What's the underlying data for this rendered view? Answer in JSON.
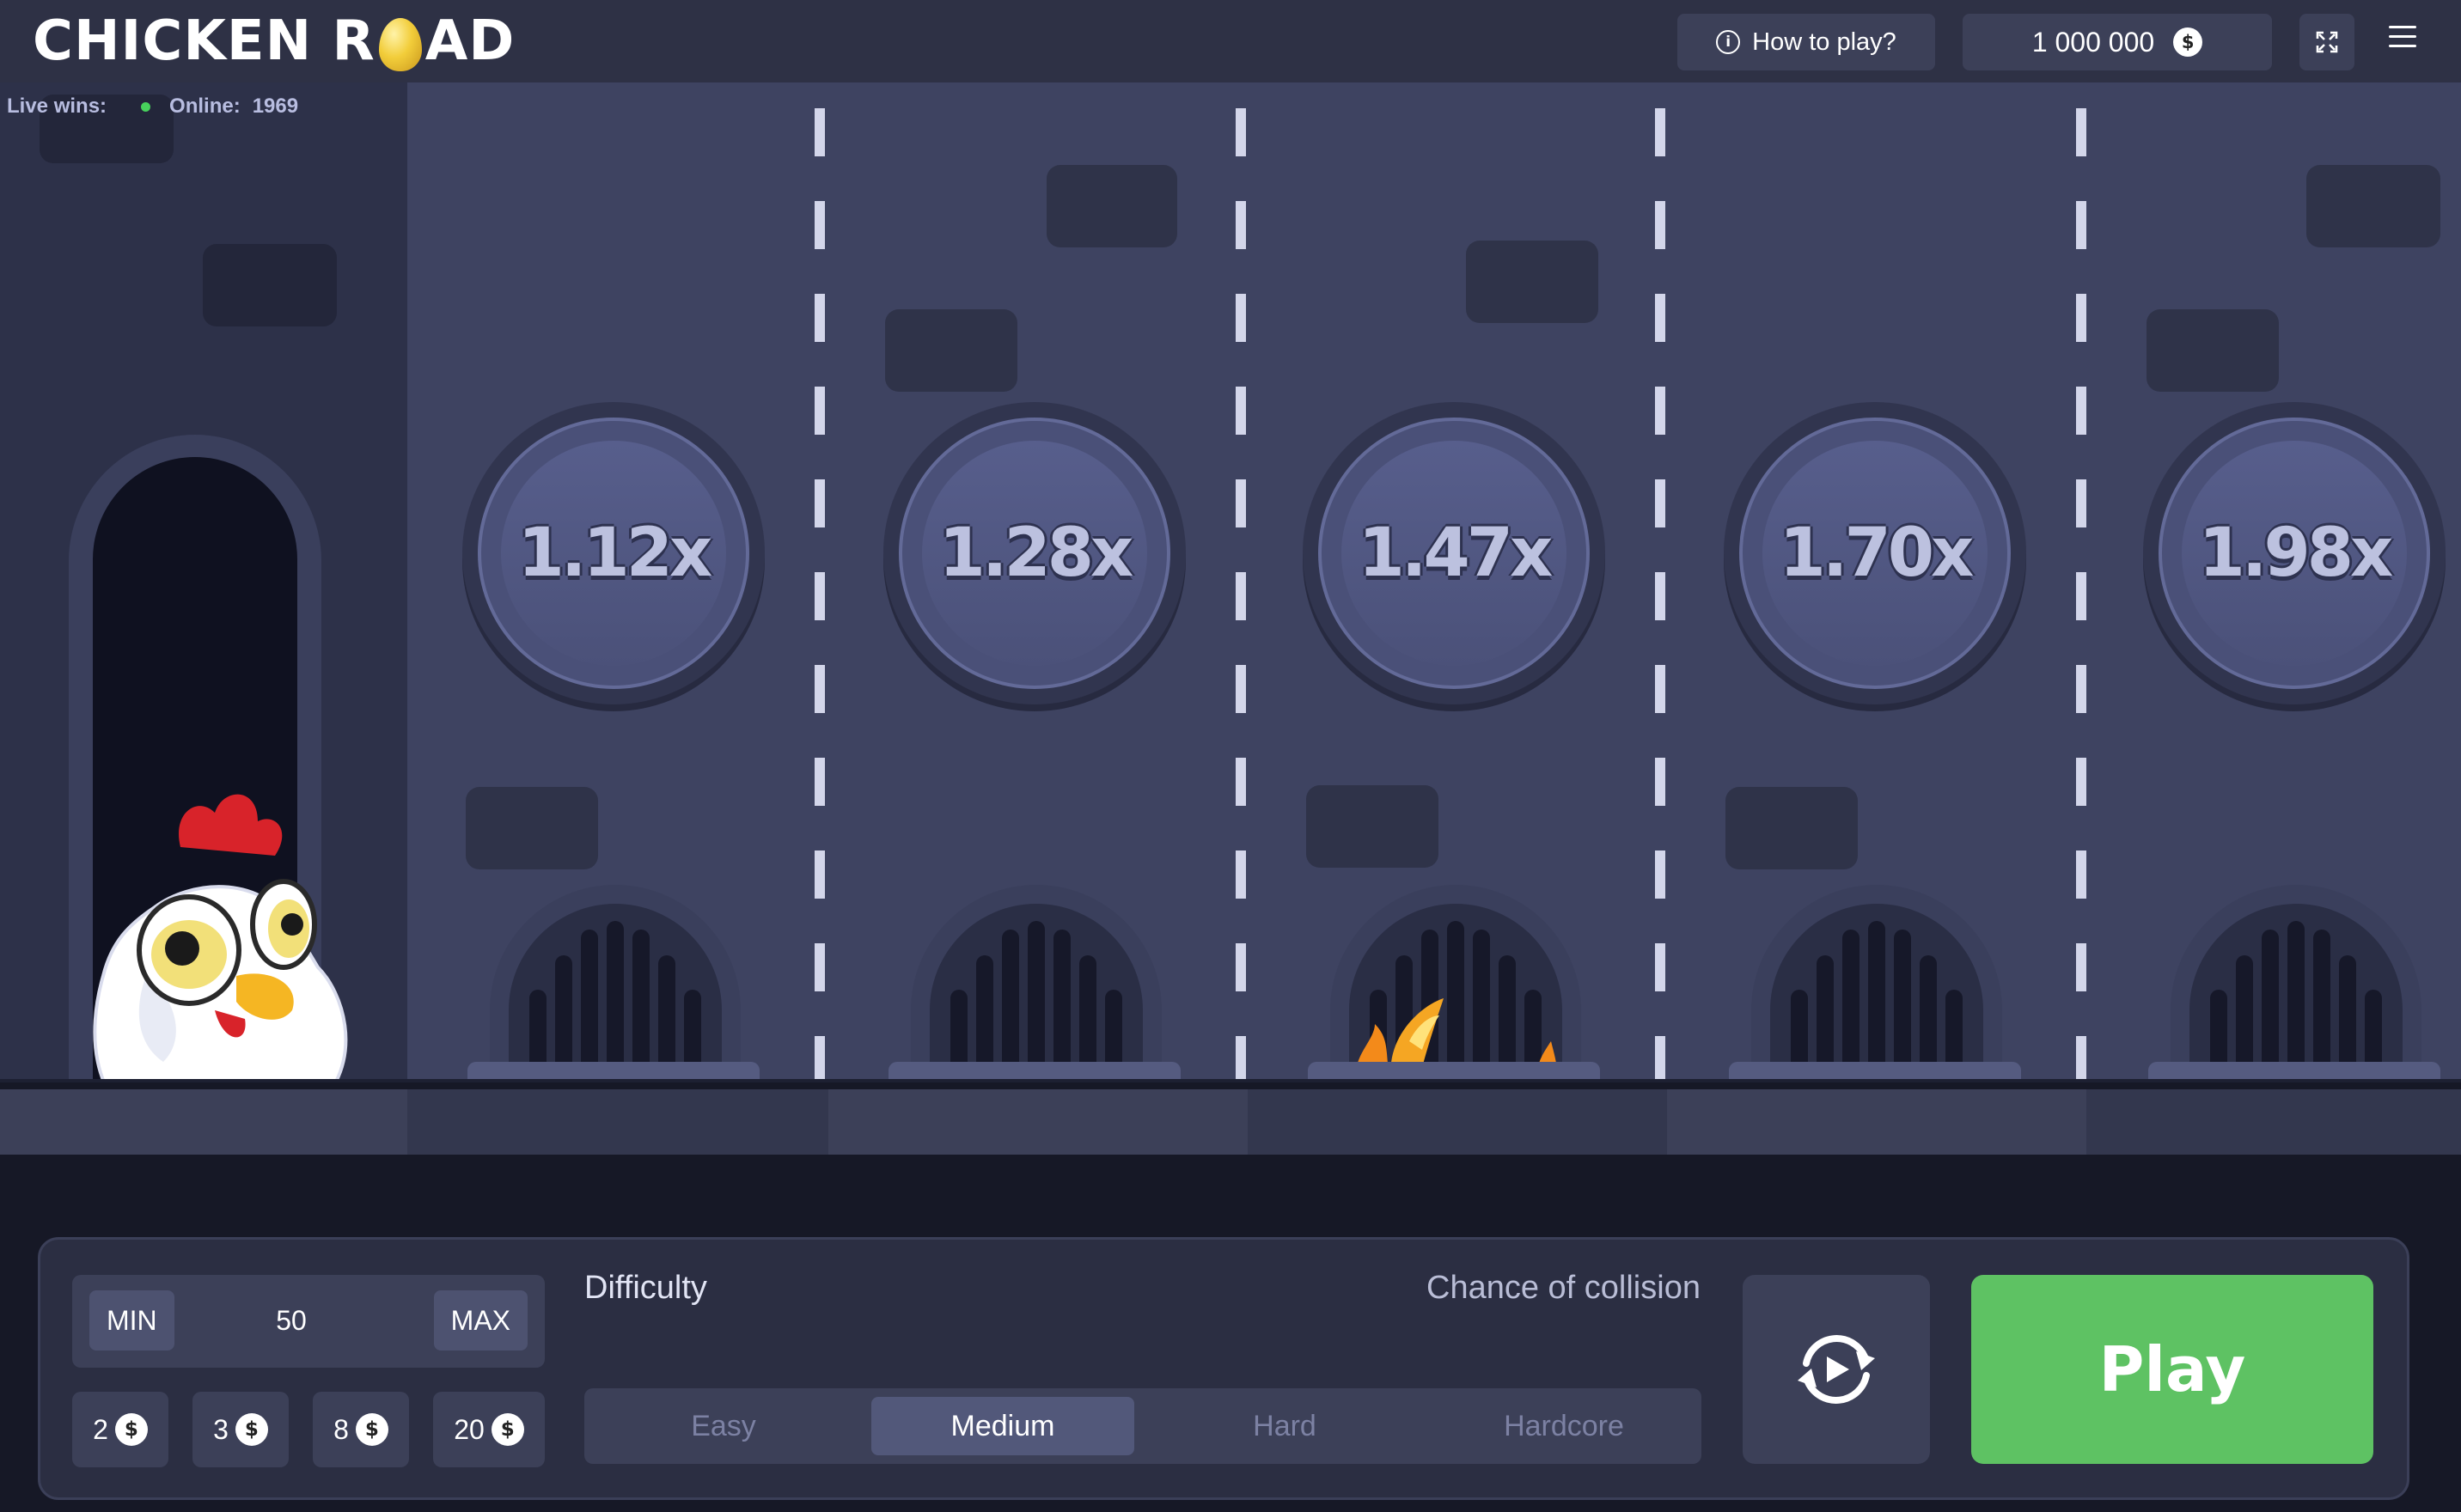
{
  "header": {
    "logo_text_1": "CHICKEN R",
    "logo_text_2": "AD",
    "how_to_play_label": "How to play?",
    "info_icon": "i",
    "balance": "1 000 000",
    "currency_icon": "$",
    "fullscreen_icon": "expand-icon",
    "menu_icon": "hamburger-icon"
  },
  "game": {
    "live_wins_label": "Live wins:",
    "online_label": "Online:",
    "online_count": "1969",
    "multipliers": [
      "1.12x",
      "1.28x",
      "1.47x",
      "1.70x",
      "1.98x"
    ]
  },
  "controls": {
    "min_label": "MIN",
    "max_label": "MAX",
    "bet_value": "50",
    "quick_bets": [
      "2",
      "3",
      "8",
      "20"
    ],
    "difficulty_label": "Difficulty",
    "collision_label": "Chance of collision",
    "difficulties": [
      "Easy",
      "Medium",
      "Hard",
      "Hardcore"
    ],
    "selected_difficulty": "Medium",
    "play_label": "Play"
  },
  "colors": {
    "play_green": "#5ec263",
    "lane_bg": "#3e4361",
    "header_bg": "#2e3145"
  }
}
